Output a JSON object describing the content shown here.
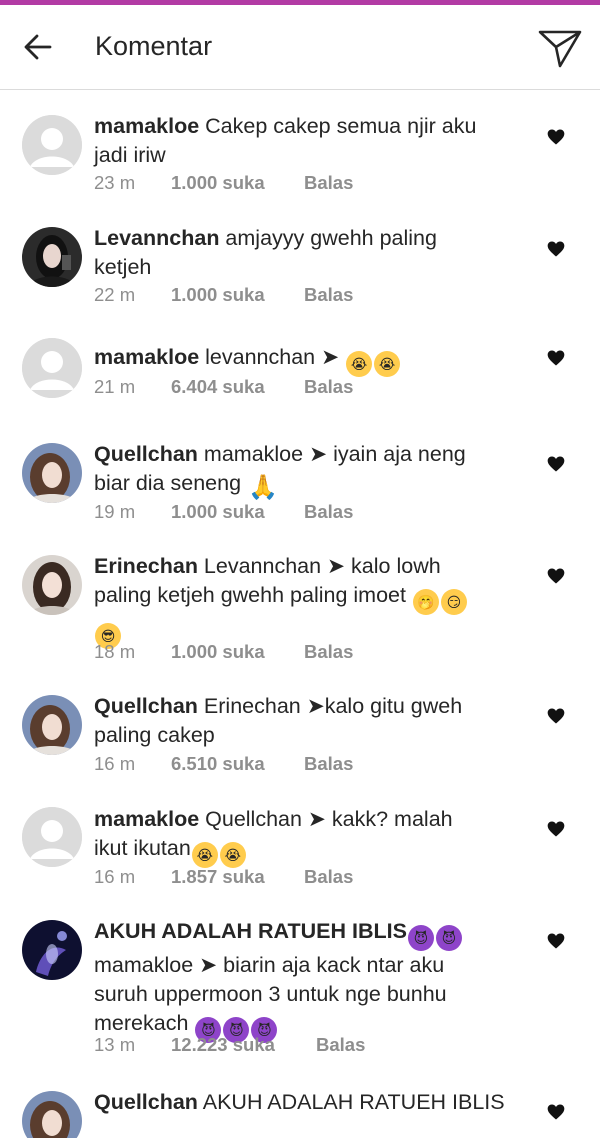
{
  "header": {
    "title": "Komentar"
  },
  "colors": {
    "accent_bar": "#b23ba4",
    "meta": "#8e8e8e",
    "text": "#262626"
  },
  "comments": [
    {
      "user": "mamakloe",
      "body_lines": [
        " Cakep cakep semua njir aku",
        "jadi iriw"
      ],
      "time": "23 m",
      "likes": "1.000 suka",
      "reply": "Balas",
      "avatar": "default"
    },
    {
      "user": "Levannchan",
      "body_lines": [
        " amjayyy gwehh paling",
        "ketjeh"
      ],
      "time": "22 m",
      "likes": "1.000 suka",
      "reply": "Balas",
      "avatar": "photo-dark"
    },
    {
      "user": "mamakloe",
      "body_lines": [
        " levannchan ➤ "
      ],
      "emoji_line1": [
        "cry",
        "cry"
      ],
      "time": "21 m",
      "likes": "6.404 suka",
      "reply": "Balas",
      "avatar": "default"
    },
    {
      "user": "Quellchan",
      "body_lines": [
        " mamakloe ➤ iyain aja neng",
        "biar dia seneng "
      ],
      "emoji_line2": [
        "pray"
      ],
      "time": "19 m",
      "likes": "1.000 suka",
      "reply": "Balas",
      "avatar": "photo-light"
    },
    {
      "user": "Erinechan",
      "body_lines": [
        " Levannchan ➤ kalo lowh",
        "paling ketjeh gwehh paling imoet "
      ],
      "emoji_line2": [
        "hush",
        "smirk"
      ],
      "emoji_line3": [
        "cool"
      ],
      "time": "18 m",
      "likes": "1.000 suka",
      "reply": "Balas",
      "avatar": "photo-light2"
    },
    {
      "user": "Quellchan",
      "body_lines": [
        " Erinechan ➤kalo gitu gweh",
        "paling cakep"
      ],
      "time": "16 m",
      "likes": "6.510 suka",
      "reply": "Balas",
      "avatar": "photo-light"
    },
    {
      "user": "mamakloe",
      "body_lines": [
        " Quellchan ➤ kakk? malah",
        "ikut ikutan"
      ],
      "emoji_line2": [
        "cry",
        "cry"
      ],
      "time": "16 m",
      "likes": "1.857 suka",
      "reply": "Balas",
      "avatar": "default"
    },
    {
      "user": "AKUH ADALAH RATUEH IBLIS",
      "body_lines": [
        "",
        "mamakloe ➤ biarin aja kack ntar aku",
        "suruh uppermoon 3 untuk nge bunhu",
        "merekach "
      ],
      "emoji_line1": [
        "devil",
        "devil"
      ],
      "emoji_line4": [
        "devil",
        "devil",
        "devil"
      ],
      "time": "13 m",
      "likes": "12.223 suka",
      "reply": "Balas",
      "avatar": "photo-night"
    },
    {
      "user": "Quellchan",
      "body_lines": [
        " AKUH ADALAH RATUEH IBLIS"
      ],
      "time": "",
      "likes": "",
      "reply": "",
      "avatar": "photo-light"
    }
  ]
}
